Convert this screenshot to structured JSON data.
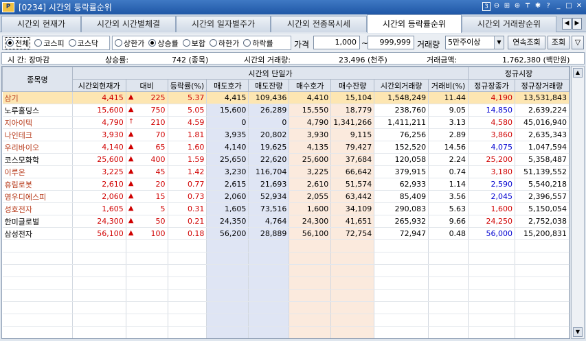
{
  "window": {
    "title": "[0234] 시간외 등락률순위",
    "logo": "P"
  },
  "window_controls": [
    "3",
    "⊖",
    "⊞",
    "⊕",
    "₸",
    "✱",
    "?",
    "_",
    "□",
    "✕"
  ],
  "tabs": [
    {
      "label": "시간외 현재가"
    },
    {
      "label": "시간외 시간별체결"
    },
    {
      "label": "시간외 일자별주가"
    },
    {
      "label": "시간외 전종목시세"
    },
    {
      "label": "시간외 등락률순위"
    },
    {
      "label": "시간외 거래량순위"
    }
  ],
  "filters": {
    "market": [
      "전체",
      "코스피",
      "코스닥"
    ],
    "rank": [
      "상한가",
      "상승률",
      "보합",
      "하한가",
      "하락률"
    ],
    "price_label": "가격",
    "price_from": "1,000",
    "tilde": "~",
    "price_to": "999,999",
    "volume_label": "거래량",
    "volume_select": "5만주이상",
    "btn_continuous": "연속조회",
    "btn_query": "조회"
  },
  "info": {
    "time_label": "시  간: 장마감",
    "up_label": "상승률:",
    "up_value": "742 (종목)",
    "vol_label": "시간외 거래량:",
    "vol_value": "23,496 (천주)",
    "amt_label": "거래금액:",
    "amt_value": "1,762,380 (백만원)"
  },
  "table": {
    "group_afterhours": "시간외 단일가",
    "group_regular": "정규시장",
    "headers": [
      "종목명",
      "시간외현재가",
      "대비",
      "등락률(%)",
      "매도호가",
      "매도잔량",
      "매수호가",
      "매수잔량",
      "시간외거래량",
      "거래비(%)",
      "정규장종가",
      "정규장거래량"
    ],
    "rows": [
      [
        "삼기",
        "4,415",
        "225",
        "5.37",
        "4,415",
        "109,436",
        "4,410",
        "15,104",
        "1,548,249",
        "11.44",
        "4,190",
        "13,531,843"
      ],
      [
        "노루홀딩스",
        "15,600",
        "750",
        "5.05",
        "15,600",
        "26,289",
        "15,550",
        "18,779",
        "238,760",
        "9.05",
        "14,850",
        "2,639,224"
      ],
      [
        "지아이텍",
        "4,790",
        "210",
        "4.59",
        "0",
        "0",
        "4,790",
        "1,341,266",
        "1,411,211",
        "3.13",
        "4,580",
        "45,016,940"
      ],
      [
        "나인테크",
        "3,930",
        "70",
        "1.81",
        "3,935",
        "20,802",
        "3,930",
        "9,115",
        "76,256",
        "2.89",
        "3,860",
        "2,635,343"
      ],
      [
        "우리바이오",
        "4,140",
        "65",
        "1.60",
        "4,140",
        "19,625",
        "4,135",
        "79,427",
        "152,520",
        "14.56",
        "4,075",
        "1,047,594"
      ],
      [
        "코스모화학",
        "25,600",
        "400",
        "1.59",
        "25,650",
        "22,620",
        "25,600",
        "37,684",
        "120,058",
        "2.24",
        "25,200",
        "5,358,487"
      ],
      [
        "이루온",
        "3,225",
        "45",
        "1.42",
        "3,230",
        "116,704",
        "3,225",
        "66,642",
        "379,915",
        "0.74",
        "3,180",
        "51,139,552"
      ],
      [
        "휴림로봇",
        "2,610",
        "20",
        "0.77",
        "2,615",
        "21,693",
        "2,610",
        "51,574",
        "62,933",
        "1.14",
        "2,590",
        "5,540,218"
      ],
      [
        "영우디에스피",
        "2,060",
        "15",
        "0.73",
        "2,060",
        "52,934",
        "2,055",
        "63,442",
        "85,409",
        "3.56",
        "2,045",
        "2,396,557"
      ],
      [
        "성호전자",
        "1,605",
        "5",
        "0.31",
        "1,605",
        "73,516",
        "1,600",
        "34,109",
        "290,083",
        "5.63",
        "1,600",
        "5,150,054"
      ],
      [
        "한미글로벌",
        "24,300",
        "50",
        "0.21",
        "24,350",
        "4,764",
        "24,300",
        "41,651",
        "265,932",
        "9.66",
        "24,250",
        "2,752,038"
      ],
      [
        "삼성전자",
        "56,100",
        "100",
        "0.18",
        "56,200",
        "28,889",
        "56,100",
        "72,754",
        "72,947",
        "0.48",
        "56,000",
        "15,200,831"
      ]
    ],
    "row_change_marks": [
      "▲",
      "▲",
      "↑",
      "▲",
      "▲",
      "▲",
      "▲",
      "▲",
      "▲",
      "▲",
      "▲",
      "▲"
    ],
    "name_colors": [
      "red",
      "black",
      "red",
      "red",
      "red",
      "black",
      "red",
      "red",
      "red",
      "red",
      "black",
      "black"
    ],
    "price_colors": [
      "up",
      "up",
      "up",
      "up",
      "up",
      "up",
      "up",
      "up",
      "up",
      "up",
      "up",
      "up"
    ],
    "close_colors": [
      "up",
      "dn",
      "up",
      "up",
      "dn",
      "up",
      "up",
      "dn",
      "dn",
      "up",
      "up",
      "dn"
    ]
  },
  "colors": {
    "up": "#d00000",
    "down": "#0000d0",
    "highlight": "#fde6b2"
  }
}
